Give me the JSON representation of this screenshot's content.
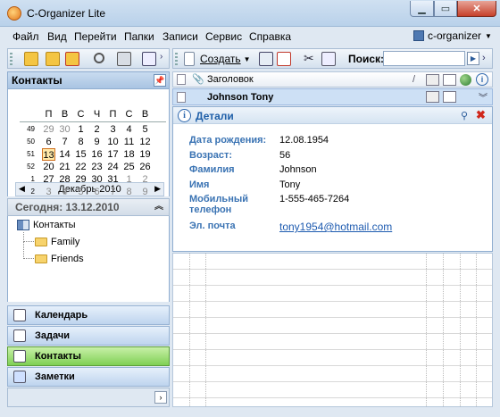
{
  "window": {
    "title": "C-Organizer Lite"
  },
  "menu": [
    "Файл",
    "Вид",
    "Перейти",
    "Папки",
    "Записи",
    "Сервис",
    "Справка"
  ],
  "organizer_selector": "c-organizer",
  "toolbar": {
    "create_label": "Создать",
    "search_label": "Поиск:",
    "search_value": ""
  },
  "left_panel": {
    "title": "Контакты"
  },
  "calendar": {
    "month_title": "Декабрь 2010",
    "weekday_headers": [
      "П",
      "В",
      "С",
      "Ч",
      "П",
      "С",
      "В"
    ],
    "weeks": [
      {
        "wk": "49",
        "days": [
          "29",
          "30",
          "1",
          "2",
          "3",
          "4",
          "5"
        ]
      },
      {
        "wk": "50",
        "days": [
          "6",
          "7",
          "8",
          "9",
          "10",
          "11",
          "12"
        ]
      },
      {
        "wk": "51",
        "days": [
          "13",
          "14",
          "15",
          "16",
          "17",
          "18",
          "19"
        ]
      },
      {
        "wk": "52",
        "days": [
          "20",
          "21",
          "22",
          "23",
          "24",
          "25",
          "26"
        ]
      },
      {
        "wk": "1",
        "days": [
          "27",
          "28",
          "29",
          "30",
          "31",
          "1",
          "2"
        ]
      },
      {
        "wk": "2",
        "days": [
          "3",
          "4",
          "5",
          "6",
          "7",
          "8",
          "9"
        ]
      }
    ],
    "today_label": "Сегодня: 13.12.2010"
  },
  "tree": {
    "root": "Контакты",
    "children": [
      "Family",
      "Friends"
    ]
  },
  "nav_buttons": [
    "Календарь",
    "Задачи",
    "Контакты",
    "Заметки"
  ],
  "grid": {
    "column_title": "Заголовок",
    "row_name": "Johnson Tony"
  },
  "details": {
    "title": "Детали",
    "fields": [
      {
        "label": "Дата рождения:",
        "value": "12.08.1954"
      },
      {
        "label": "Возраст:",
        "value": "56"
      },
      {
        "label": "Фамилия",
        "value": "Johnson"
      },
      {
        "label": "Имя",
        "value": "Tony"
      },
      {
        "label": "Мобильный телефон",
        "value": "1-555-465-7264"
      },
      {
        "label": "Эл. почта",
        "value": "tony1954@hotmail.com"
      }
    ]
  },
  "colors": {
    "accent": "#3a73b3",
    "active_nav": "#7fd054",
    "today": "#ffe9a8"
  }
}
